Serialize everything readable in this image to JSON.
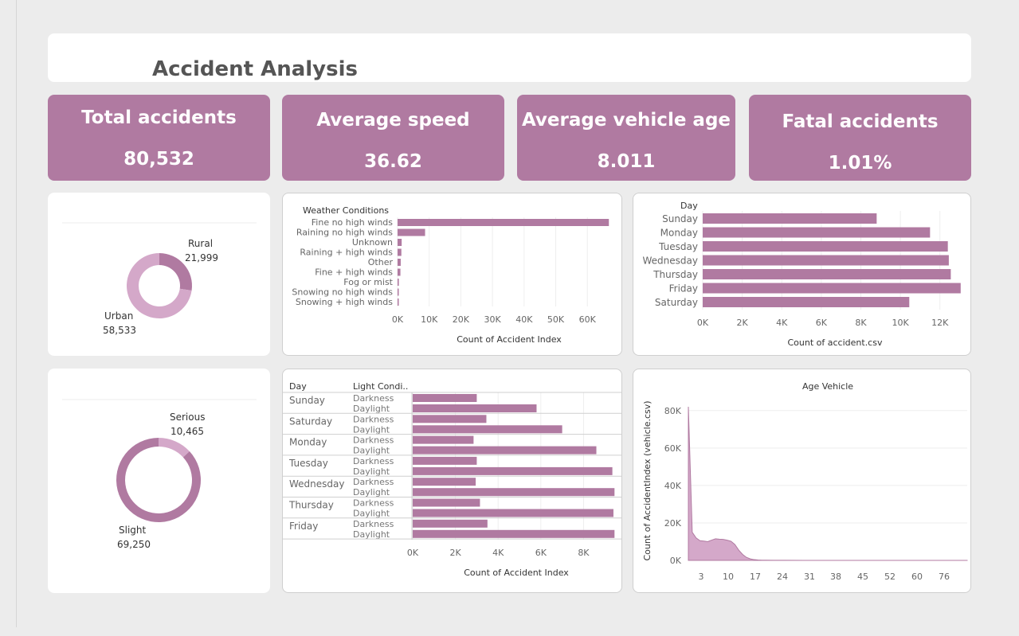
{
  "title": "Accident Analysis",
  "accent_color": "#b07aa1",
  "light_accent_color": "#d4a8c9",
  "kpis": [
    {
      "label": "Total accidents",
      "value": "80,532"
    },
    {
      "label": "Average speed",
      "value": "36.62"
    },
    {
      "label": "Average vehicle age",
      "value": "8.011"
    },
    {
      "label": "Fatal accidents",
      "value": "1.01%"
    }
  ],
  "donut_area": {
    "slices": [
      {
        "label": "Rural",
        "value_text": "21,999",
        "value": 21999
      },
      {
        "label": "Urban",
        "value_text": "58,533",
        "value": 58533
      }
    ]
  },
  "donut_severity": {
    "slices": [
      {
        "label": "Serious",
        "value_text": "10,465",
        "value": 10465
      },
      {
        "label": "Slight",
        "value_text": "69,250",
        "value": 69250
      }
    ]
  },
  "chart_data": [
    {
      "type": "bar",
      "orientation": "horizontal",
      "category_header": "Weather Conditions",
      "categories": [
        "Fine no high winds",
        "Raining no high winds",
        "Unknown",
        "Raining + high winds",
        "Other",
        "Fine + high winds",
        "Fog or mist",
        "Snowing no high winds",
        "Snowing + high winds"
      ],
      "values": [
        66800,
        8700,
        1300,
        1200,
        1000,
        900,
        400,
        300,
        200
      ],
      "xlabel": "Count of Accident Index",
      "xticks": [
        "0K",
        "10K",
        "20K",
        "30K",
        "40K",
        "50K",
        "60K"
      ],
      "xlim": [
        0,
        68000
      ]
    },
    {
      "type": "bar",
      "orientation": "horizontal",
      "category_header": "Day",
      "categories": [
        "Sunday",
        "Monday",
        "Tuesday",
        "Wednesday",
        "Thursday",
        "Friday",
        "Saturday"
      ],
      "values": [
        8800,
        11500,
        12400,
        12450,
        12550,
        13050,
        10450
      ],
      "xlabel": "Count of accident.csv",
      "xticks": [
        "0K",
        "2K",
        "4K",
        "6K",
        "8K",
        "10K",
        "12K"
      ],
      "xlim": [
        0,
        13300
      ]
    },
    {
      "type": "bar",
      "orientation": "horizontal",
      "row_headers": [
        "Day",
        "Light Condi.."
      ],
      "groups": [
        {
          "day": "Sunday",
          "rows": [
            {
              "light": "Darkness",
              "value": 3000
            },
            {
              "light": "Daylight",
              "value": 5800
            }
          ]
        },
        {
          "day": "Saturday",
          "rows": [
            {
              "light": "Darkness",
              "value": 3450
            },
            {
              "light": "Daylight",
              "value": 7000
            }
          ]
        },
        {
          "day": "Monday",
          "rows": [
            {
              "light": "Darkness",
              "value": 2850
            },
            {
              "light": "Daylight",
              "value": 8600
            }
          ]
        },
        {
          "day": "Tuesday",
          "rows": [
            {
              "light": "Darkness",
              "value": 3000
            },
            {
              "light": "Daylight",
              "value": 9350
            }
          ]
        },
        {
          "day": "Wednesday",
          "rows": [
            {
              "light": "Darkness",
              "value": 2950
            },
            {
              "light": "Daylight",
              "value": 9450
            }
          ]
        },
        {
          "day": "Thursday",
          "rows": [
            {
              "light": "Darkness",
              "value": 3150
            },
            {
              "light": "Daylight",
              "value": 9400
            }
          ]
        },
        {
          "day": "Friday",
          "rows": [
            {
              "light": "Darkness",
              "value": 3500
            },
            {
              "light": "Daylight",
              "value": 9450
            }
          ]
        }
      ],
      "xlabel": "Count of Accident Index",
      "xticks": [
        "0K",
        "2K",
        "4K",
        "6K",
        "8K"
      ],
      "xlim": [
        0,
        9700
      ]
    },
    {
      "type": "area",
      "title": "Age Vehicle",
      "ylabel": "Count of AccidentIndex (vehicle.csv)",
      "xticks": [
        "3",
        "10",
        "17",
        "24",
        "31",
        "38",
        "45",
        "52",
        "60",
        "76"
      ],
      "yticks": [
        "0K",
        "20K",
        "40K",
        "60K",
        "80K"
      ],
      "ylim": [
        0,
        85000
      ],
      "xlim": [
        0,
        72
      ],
      "x": [
        0,
        1,
        2,
        3,
        4,
        5,
        6,
        7,
        8,
        9,
        10,
        11,
        12,
        13,
        14,
        15,
        16,
        17,
        18,
        19,
        20,
        22,
        25,
        30,
        40,
        50,
        60,
        72
      ],
      "y": [
        82000,
        15000,
        12000,
        10500,
        10300,
        10000,
        10800,
        11500,
        11300,
        11200,
        10800,
        10200,
        8500,
        5500,
        3200,
        1600,
        800,
        400,
        200,
        120,
        80,
        50,
        30,
        20,
        10,
        8,
        5,
        5
      ]
    }
  ]
}
